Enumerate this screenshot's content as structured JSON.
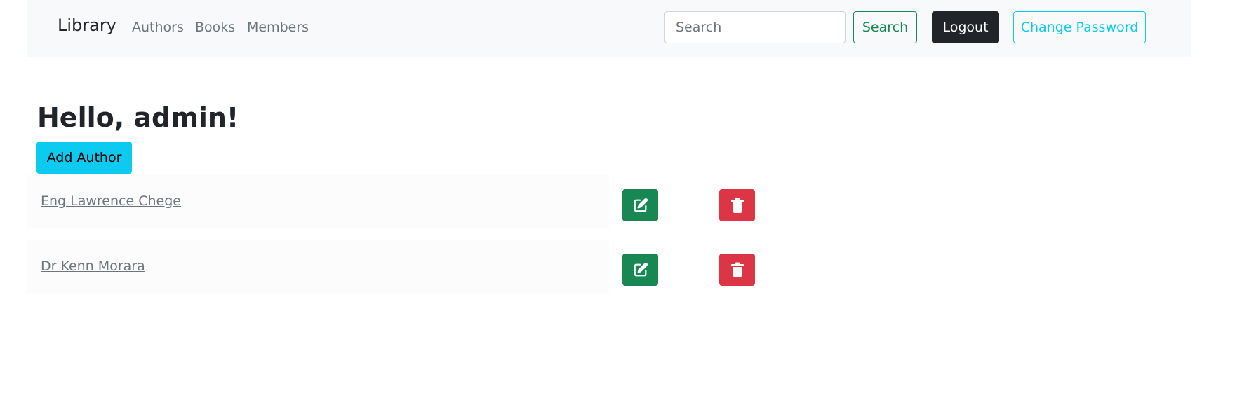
{
  "navbar": {
    "brand": "Library",
    "links": [
      {
        "label": "Authors"
      },
      {
        "label": "Books"
      },
      {
        "label": "Members"
      }
    ],
    "search": {
      "placeholder": "Search",
      "value": ""
    },
    "search_button": "Search",
    "logout_button": "Logout",
    "change_password_button": "Change Password"
  },
  "main": {
    "greeting": "Hello, admin!",
    "add_author_button": "Add Author",
    "authors": [
      {
        "name": "Eng Lawrence Chege"
      },
      {
        "name": "Dr Kenn Morara"
      }
    ]
  },
  "icons": {
    "edit": "pencil-square-icon",
    "delete": "trash-icon"
  },
  "colors": {
    "success": "#198754",
    "danger": "#dc3545",
    "info": "#0dcaf0",
    "dark": "#212529",
    "navbar_bg": "#f8f9fa"
  }
}
